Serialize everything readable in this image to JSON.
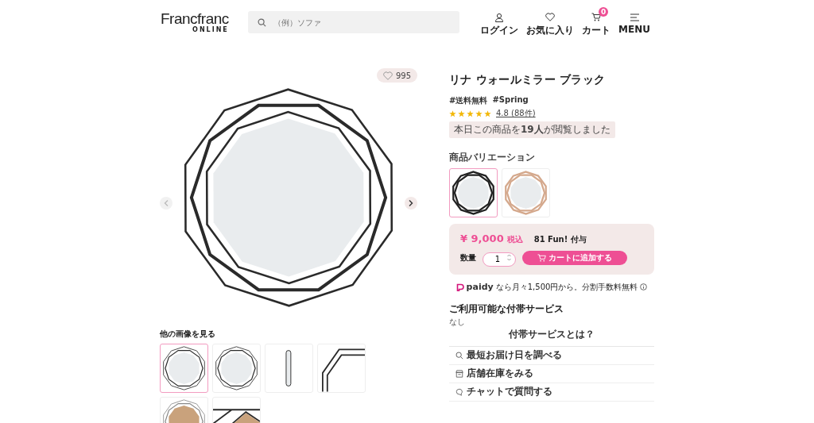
{
  "header": {
    "logo": "Francfranc",
    "logo_sub": "ONLINE",
    "search": {
      "placeholder": "（例）ソファ"
    },
    "nav": [
      {
        "kind": "user",
        "label": "ログイン"
      },
      {
        "kind": "heart",
        "label": "お気に入り"
      },
      {
        "kind": "cart",
        "label": "カート",
        "badge": "0"
      },
      {
        "kind": "menu",
        "label": "MENU"
      }
    ]
  },
  "gallery": {
    "likes": "995",
    "more_label": "他の画像を見る",
    "thumbnails": [
      {
        "kind": "front",
        "selected": true
      },
      {
        "kind": "front",
        "selected": false
      },
      {
        "kind": "side",
        "selected": false
      },
      {
        "kind": "detail",
        "selected": false
      },
      {
        "kind": "back",
        "selected": false
      },
      {
        "kind": "hook",
        "selected": false
      }
    ]
  },
  "product": {
    "title": "リナ ウォールミラー ブラック",
    "tags": [
      "#送料無料",
      "#Spring"
    ],
    "stars": 5,
    "rating": "4.8 (88件)",
    "views": "本日この商品を**19人**が閲覧しました",
    "variation_label": "商品バリエーション",
    "variations": [
      {
        "color": "#222222",
        "selected": true
      },
      {
        "color": "#d4a88c",
        "selected": false
      }
    ],
    "price": "¥ 9,000",
    "tax": "税込",
    "points": "81 Fun! 付与",
    "qty_label": "数量",
    "qty": "1",
    "add_to_cart": "カートに追加する",
    "paidy_logo": "paidy",
    "paidy_text": "なら月々1,500円から。分割手数料無料",
    "services_heading": "ご利用可能な付帯サービス",
    "services_value": "なし",
    "services_link": "付帯サービスとは？",
    "actions": [
      {
        "kind": "search",
        "label": "最短お届け日を調べる"
      },
      {
        "kind": "store",
        "label": "店舗在庫をみる"
      },
      {
        "kind": "chat",
        "label": "チャットで質問する"
      }
    ]
  }
}
